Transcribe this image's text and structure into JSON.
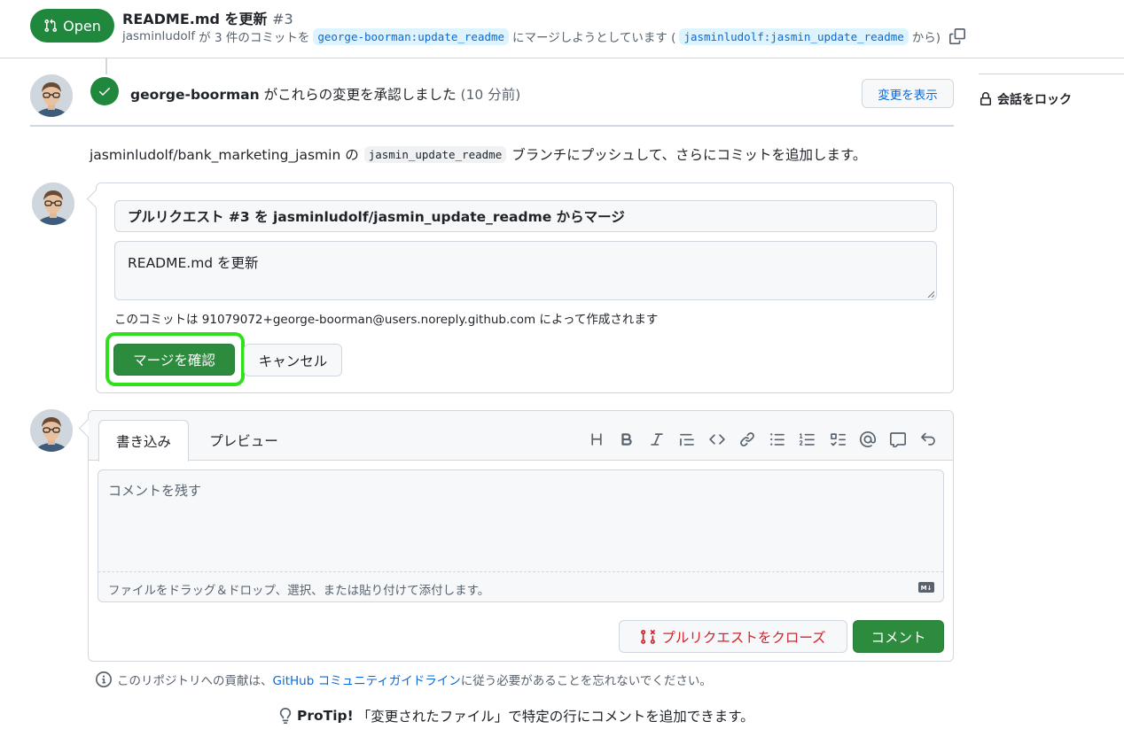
{
  "header": {
    "state_label": "Open",
    "title": "README.md を更新",
    "number": "#3",
    "meta": {
      "author": "jasminludolf",
      "text_count": "が 3 件のコミットを",
      "base_branch": "george-boorman:update_readme",
      "text_merge": "にマージしようとしています (",
      "head_branch": "jasminludolf:jasmin_update_readme",
      "text_from": "から)"
    }
  },
  "sidebar": {
    "lock_label": "会話をロック"
  },
  "review": {
    "reviewer": "george-boorman",
    "text": "がこれらの変更を承認しました",
    "ago": "(10 分前)",
    "view_changes_label": "変更を表示"
  },
  "push_note": {
    "repo": "jasminludolf/bank_marketing_jasmin の",
    "branch": "jasmin_update_readme",
    "text": "ブランチにプッシュして、さらにコミットを追加します。"
  },
  "merge": {
    "title_value": "プルリクエスト #3 を jasminludolf/jasmin_update_readme からマージ",
    "body_value": "README.md を更新",
    "author_note": "このコミットは 91079072+george-boorman@users.noreply.github.com によって作成されます",
    "confirm_label": "マージを確認",
    "cancel_label": "キャンセル"
  },
  "comment": {
    "tab_write": "書き込み",
    "tab_preview": "プレビュー",
    "placeholder": "コメントを残す",
    "attach_text": "ファイルをドラッグ＆ドロップ、選択、または貼り付けて添付します。",
    "close_pr_label": "プルリクエストをクローズ",
    "comment_label": "コメント",
    "toolbar": [
      "heading-icon",
      "bold-icon",
      "italic-icon",
      "quote-icon",
      "code-icon",
      "link-icon",
      "unordered-list-icon",
      "ordered-list-icon",
      "task-list-icon",
      "mention-icon",
      "reference-icon",
      "undo-icon"
    ]
  },
  "footer": {
    "guideline_prefix": "このリポジトリへの貢献は、",
    "guideline_link": "GitHub コミュニティガイドライン",
    "guideline_suffix": "に従う必要があることを忘れないでください。",
    "protip_label": "ProTip!",
    "protip_text": "「変更されたファイル」で特定の行にコメントを追加できます。"
  },
  "colors": {
    "open_green": "#1f883d",
    "confirm_green": "#2c8b3c",
    "highlight_ring": "#2fe01a",
    "link_blue": "#0969da",
    "danger_red": "#d1242f"
  }
}
